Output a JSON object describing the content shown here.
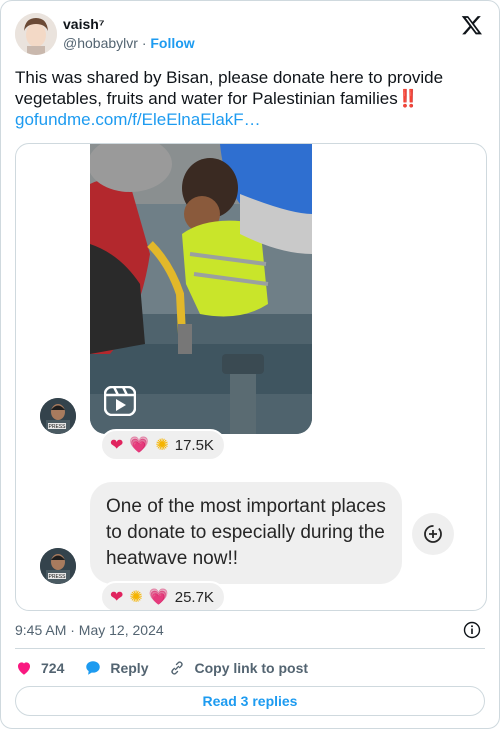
{
  "author": {
    "name": "vaish⁷",
    "handle": "@hobabylvr",
    "separator": "·",
    "follow_label": "Follow"
  },
  "tweet": {
    "text": "This was shared by Bisan, please donate here to provide vegetables, fruits and water for Palestinian families",
    "emphasis": "‼️",
    "link": "gofundme.com/f/EleElnaElakF…"
  },
  "embed": {
    "video_reactions": {
      "emojis": [
        "heart",
        "pink-heart",
        "sparkle"
      ],
      "count": "17.5K"
    },
    "message": "One of the most important places to donate to especially during the heatwave now!!",
    "message_reactions": {
      "emojis": [
        "heart",
        "sparkle",
        "pink-heart"
      ],
      "count": "25.7K"
    },
    "avatar_badge": "PRESS"
  },
  "meta": {
    "timestamp": "9:45 AM · May 12, 2024"
  },
  "actions": {
    "like_count": "724",
    "reply_label": "Reply",
    "copy_label": "Copy link to post"
  },
  "read_replies_label": "Read 3 replies",
  "colors": {
    "accent": "#1d9bf0",
    "like": "#f91880",
    "text_secondary": "#536471",
    "border": "#cfd9de"
  }
}
